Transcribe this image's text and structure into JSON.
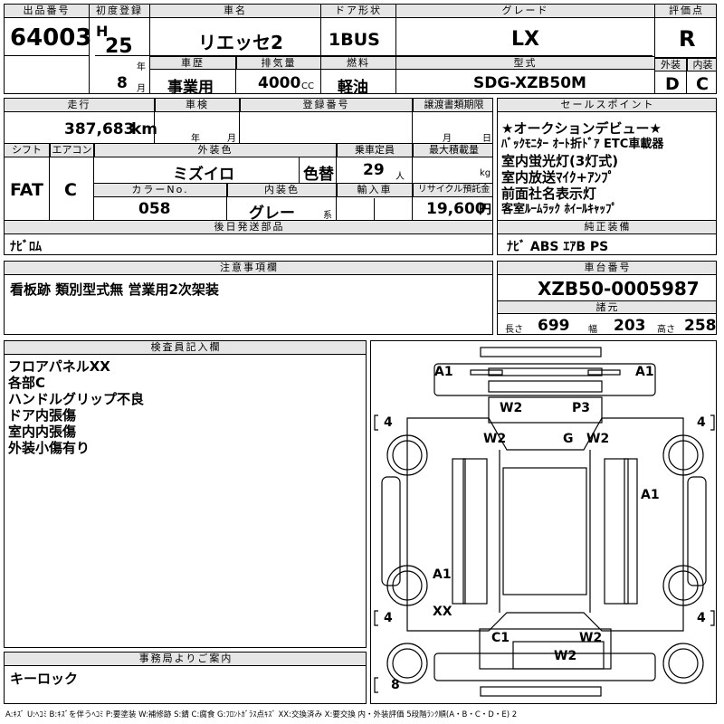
{
  "header": {
    "lot_label": "出品番号",
    "lot_no": "64003",
    "reg_label": "初度登録",
    "era": "H",
    "year": "25",
    "year_unit": "年",
    "month": "8",
    "month_unit": "月",
    "name_label": "車名",
    "car_name": "リエッセ2",
    "history_label": "車歴",
    "history": "事業用",
    "disp_label": "排気量",
    "displacement": "4000",
    "disp_unit": "CC",
    "door_label": "ドア形状",
    "door": "1BUS",
    "fuel_label": "燃料",
    "fuel": "軽油",
    "grade_label": "グレード",
    "grade": "LX",
    "model_label": "型式",
    "model": "SDG-XZB50M",
    "score_label": "評価点",
    "score": "R",
    "ext_label": "外装",
    "ext": "D",
    "int_label": "内装",
    "int": "C"
  },
  "row2": {
    "mileage_label": "走行",
    "mileage": "387,683",
    "mileage_unit": "km",
    "inspection_label": "車検",
    "insp_year_unit": "年",
    "insp_month_unit": "月",
    "regno_label": "登録番号",
    "transfer_label": "譲渡書類期限",
    "transfer_month_unit": "月",
    "transfer_day_unit": "日",
    "shift_label": "シフト",
    "shift": "FAT",
    "ac_label": "エアコン",
    "ac": "C",
    "color_label": "外装色",
    "color": "ミズイロ",
    "color_change": "色替",
    "capacity_label": "乗車定員",
    "capacity": "29",
    "capacity_unit": "人",
    "load_label": "最大積載量",
    "load_unit": "kg",
    "colorno_label": "カラーNo.",
    "colorno": "058",
    "intcolor_label": "内装色",
    "intcolor": "グレー",
    "intcolor_unit": "系",
    "import_label": "輸入車",
    "recycle_label": "リサイクル預託金",
    "recycle": "19,600",
    "recycle_unit": "円",
    "later_label": "後日発送部品",
    "later": "ﾅﾋﾞﾛﾑ"
  },
  "sales": {
    "label": "セールスポイント",
    "lines": [
      "★オークションデビュー★",
      "ﾊﾞｯｸﾓﾆﾀｰ ｵｰﾄ折ﾄﾞｱ ETC車載器",
      "室内蛍光灯(3灯式)",
      "室内放送ﾏｲｸ+ｱﾝﾌﾟ",
      "前面社名表示灯",
      "客室ﾙｰﾑﾗｯｸ ﾎｲｰﾙｷｬｯﾌﾟ"
    ],
    "equip_label": "純正装備",
    "equip": "ﾅﾋﾞ ABS ｴｱB PS"
  },
  "notes": {
    "label": "注意事項欄",
    "text": "看板跡 類別型式無 営業用2次架装"
  },
  "chassis": {
    "label": "車台番号",
    "number": "XZB50-0005987",
    "spec_label": "諸元",
    "len_label": "長さ",
    "length": "699",
    "wid_label": "幅",
    "width": "203",
    "hei_label": "高さ",
    "height": "258"
  },
  "inspector": {
    "label": "検査員記入欄",
    "lines": [
      "フロアパネルXX",
      "各部C",
      "ハンドルグリップ不良",
      "ドア内張傷",
      "室内内張傷",
      "外装小傷有り"
    ]
  },
  "office": {
    "label": "事務局よりご案内",
    "text": "キーロック"
  },
  "diagram": {
    "marks": [
      "A1",
      "A1",
      "W2",
      "P3",
      "W2",
      "G",
      "W2",
      "A1",
      "A1",
      "XX",
      "C1",
      "W2",
      "W2"
    ],
    "tires": [
      "4",
      "4",
      "4",
      "4",
      "8"
    ]
  },
  "legend": "A:ｷｽﾞ U:ﾍｺﾐ B:ｷｽﾞを伴うﾍｺﾐ P:要塗装 W:補修跡 S:錆 C:腐食 G:ﾌﾛﾝﾄｶﾞﾗｽ点ｷｽﾞ XX:交換済み X:要交換 内・外装評価 5段階ﾗﾝｸ順(A・B・C・D・E) 2"
}
